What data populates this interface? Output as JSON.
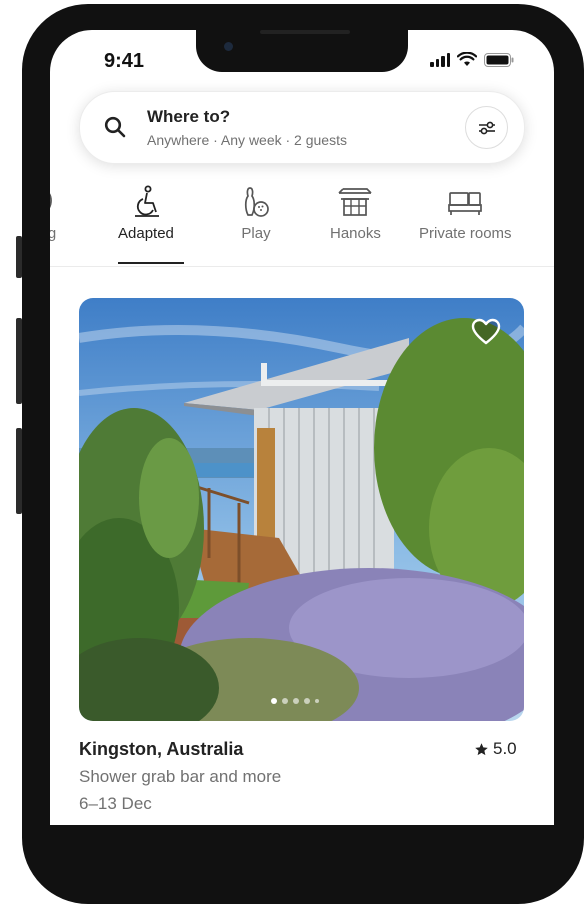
{
  "status_bar": {
    "time": "9:41"
  },
  "search": {
    "title": "Where to?",
    "subtitle": "Anywhere · Any week · 2 guests"
  },
  "categories": [
    {
      "label": "ding",
      "icon": "surfing-icon",
      "active": false
    },
    {
      "label": "Adapted",
      "icon": "wheelchair-icon",
      "active": true
    },
    {
      "label": "Play",
      "icon": "bowling-icon",
      "active": false
    },
    {
      "label": "Hanoks",
      "icon": "hanok-icon",
      "active": false
    },
    {
      "label": "Private rooms",
      "icon": "bed-icon",
      "active": false
    }
  ],
  "listing": {
    "location": "Kingston, Australia",
    "rating": "5.0",
    "description": "Shower grab bar and more",
    "dates": "6–13 Dec",
    "photo_count": 5,
    "photo_index": 1
  },
  "colors": {
    "accent_text": "#222222",
    "muted_text": "#717171"
  }
}
